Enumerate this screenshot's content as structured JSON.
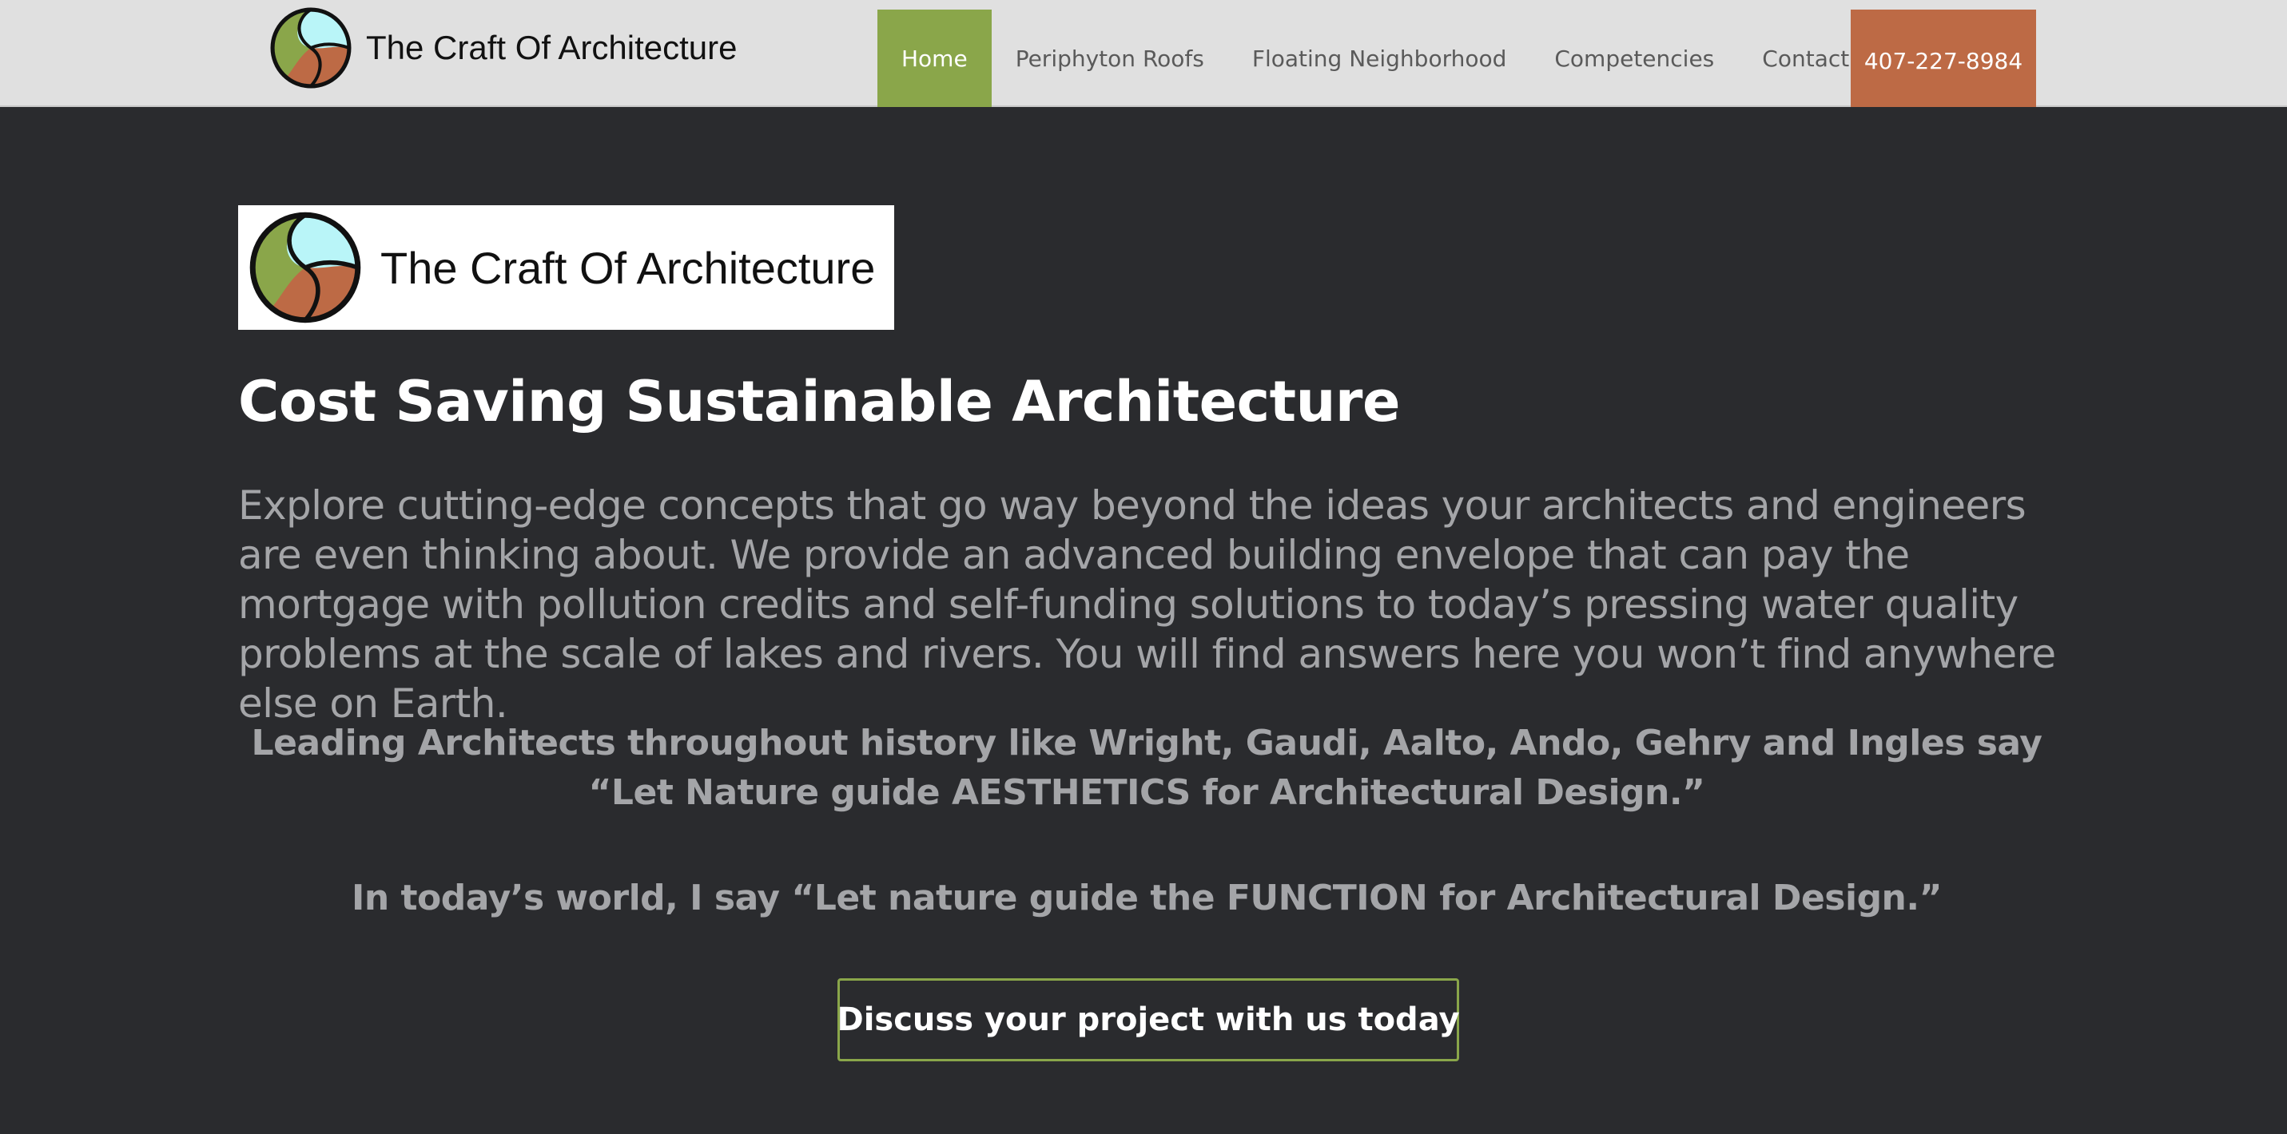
{
  "brand": {
    "name": "The Craft Of Architecture",
    "logo_icon": "tri-swirl-logo-icon"
  },
  "nav": {
    "items": [
      {
        "label": "Home",
        "active": true
      },
      {
        "label": "Periphyton Roofs",
        "active": false
      },
      {
        "label": "Floating Neighborhood",
        "active": false
      },
      {
        "label": "Competencies",
        "active": false
      },
      {
        "label": "Contact",
        "active": false
      }
    ],
    "phone": "407-227-8984"
  },
  "hero": {
    "logo_text": "The Craft Of Architecture",
    "title": "Cost Saving Sustainable Architecture",
    "intro": "Explore cutting-edge concepts that go way beyond the ideas your architects and engineers are even thinking about. We provide an advanced building envelope that can pay the mortgage with pollution credits and self-funding solutions to today’s pressing water quality problems at the scale of lakes and rivers. You will find answers here you won’t find anywhere else on Earth.",
    "quote_1": "Leading Architects throughout history like Wright, Gaudi, Aalto, Ando, Gehry and Ingles say “Let Nature guide AESTHETICS for Architectural Design.”",
    "quote_2": "In today’s world, I say “Let nature guide the FUNCTION for Architectural Design.”",
    "cta_label": "Discuss your project with us today"
  },
  "colors": {
    "header_bg": "#e0e0e0",
    "page_bg": "#2a2b2e",
    "accent_green": "#8aa64a",
    "accent_orange": "#bd6a45",
    "logo_blue": "#b9f5f8",
    "logo_green": "#8aa64a",
    "logo_brown": "#bd6a45",
    "body_text": "#a4a5a8"
  }
}
